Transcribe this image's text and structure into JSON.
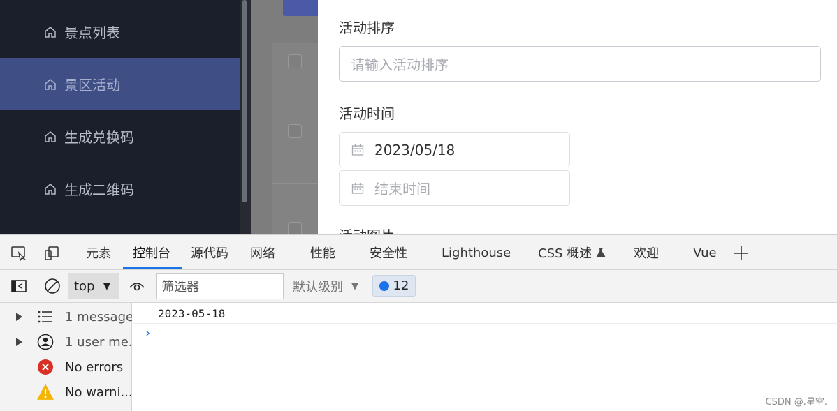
{
  "sidebar": {
    "items": [
      {
        "label": "景点列表",
        "icon": "home-icon"
      },
      {
        "label": "景区活动",
        "icon": "home-icon",
        "active": true
      },
      {
        "label": "生成兑换码",
        "icon": "home-icon"
      },
      {
        "label": "生成二维码",
        "icon": "home-icon"
      }
    ]
  },
  "dialog": {
    "sort_label": "活动排序",
    "sort_placeholder": "请输入活动排序",
    "time_label": "活动时间",
    "start_date": "2023/05/18",
    "end_placeholder": "结束时间",
    "image_label": "活动图片"
  },
  "devtools": {
    "tabs": [
      {
        "label": "元素"
      },
      {
        "label": "控制台",
        "active": true
      },
      {
        "label": "源代码"
      },
      {
        "label": "网络"
      },
      {
        "label": "性能"
      },
      {
        "label": "安全性"
      },
      {
        "label": "Lighthouse"
      },
      {
        "label": "CSS 概述"
      },
      {
        "label": "欢迎"
      },
      {
        "label": "Vue"
      }
    ],
    "context": "top",
    "filter_placeholder": "筛选器",
    "level": "默认级别",
    "issues_count": "12",
    "sidebar": [
      {
        "label": "1 message"
      },
      {
        "label": "1 user me..."
      },
      {
        "label": "No errors"
      },
      {
        "label": "No warni..."
      }
    ],
    "log_output": "2023-05-18",
    "prompt": "›"
  },
  "watermark": "CSDN @.星空."
}
